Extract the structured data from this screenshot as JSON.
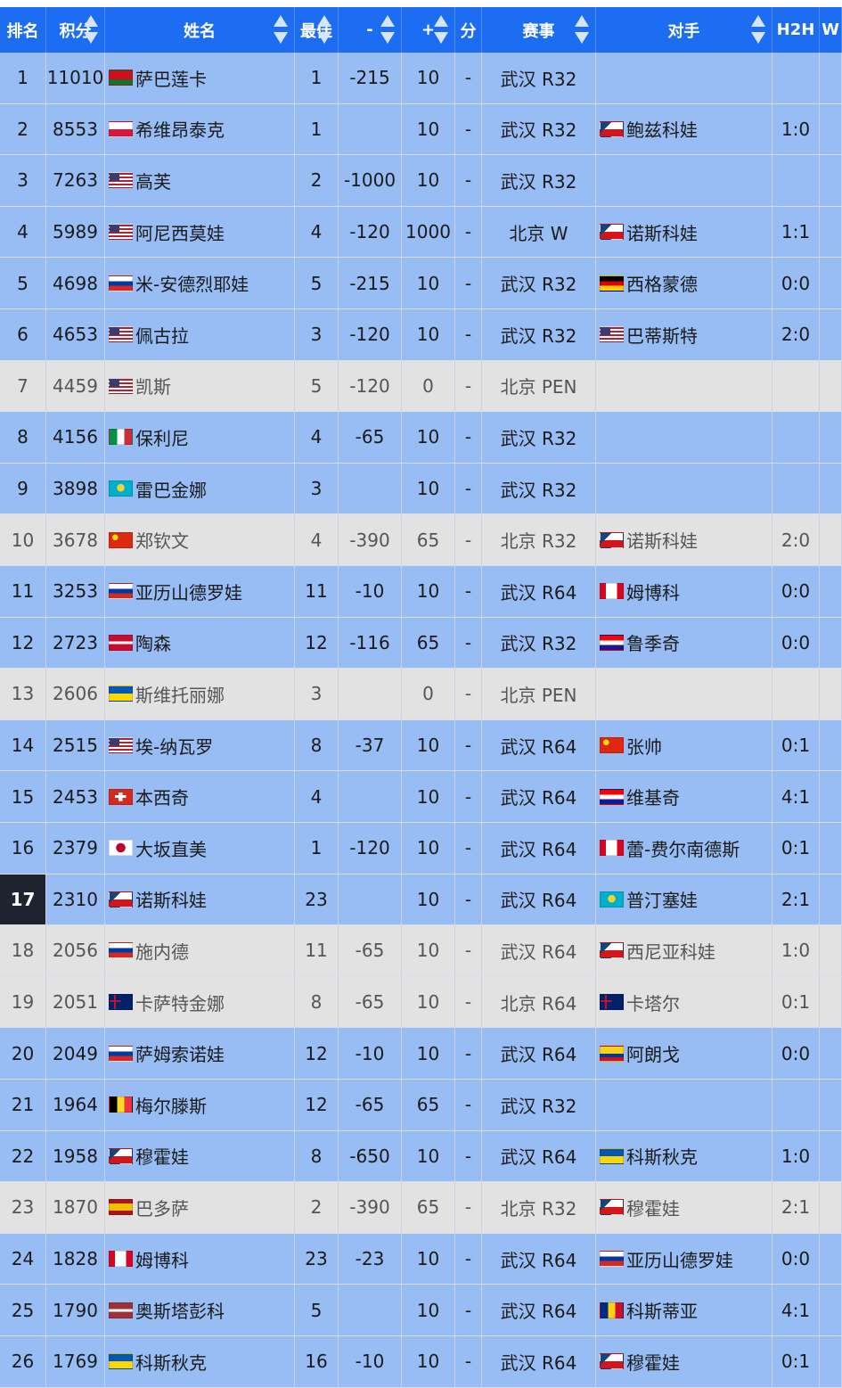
{
  "columns": [
    {
      "label": "排名",
      "sortable": false
    },
    {
      "label": "积分",
      "sortable": true
    },
    {
      "label": "姓名",
      "sortable": true
    },
    {
      "label": "最佳",
      "sortable": true
    },
    {
      "label": "-",
      "sortable": true
    },
    {
      "label": "+",
      "sortable": true
    },
    {
      "label": "分",
      "sortable": true
    },
    {
      "label": "赛事",
      "sortable": true
    },
    {
      "label": "对手",
      "sortable": true
    },
    {
      "label": "H2H",
      "sortable": false
    },
    {
      "label": "W",
      "sortable": false
    }
  ],
  "highlight_rank": "17",
  "colors": {
    "header": "#1c6df2",
    "row_active": "#97bdf4",
    "row_out": "#e2e2e2",
    "rank_badge": "#1d2430"
  },
  "rows": [
    {
      "rank": "1",
      "points": "11010",
      "flag": "BLR",
      "name": "萨巴莲卡",
      "best": "1",
      "minus": "-215",
      "plus": "10",
      "dash": "-",
      "event": "武汉 R32",
      "opp_flag": "",
      "opponent": "",
      "h2h": "",
      "status": "active"
    },
    {
      "rank": "2",
      "points": "8553",
      "flag": "POL",
      "name": "希维昂泰克",
      "best": "1",
      "minus": "",
      "plus": "10",
      "dash": "-",
      "event": "武汉 R32",
      "opp_flag": "CZE",
      "opponent": "鲍兹科娃",
      "h2h": "1:0",
      "status": "active"
    },
    {
      "rank": "3",
      "points": "7263",
      "flag": "USA",
      "name": "高芙",
      "best": "2",
      "minus": "-1000",
      "plus": "10",
      "dash": "-",
      "event": "武汉 R32",
      "opp_flag": "",
      "opponent": "",
      "h2h": "",
      "status": "active"
    },
    {
      "rank": "4",
      "points": "5989",
      "flag": "USA",
      "name": "阿尼西莫娃",
      "best": "4",
      "minus": "-120",
      "plus": "1000",
      "dash": "-",
      "event": "北京 W",
      "opp_flag": "CZE",
      "opponent": "诺斯科娃",
      "h2h": "1:1",
      "status": "active"
    },
    {
      "rank": "5",
      "points": "4698",
      "flag": "RUS",
      "name": "米-安德烈耶娃",
      "best": "5",
      "minus": "-215",
      "plus": "10",
      "dash": "-",
      "event": "武汉 R32",
      "opp_flag": "GER",
      "opponent": "西格蒙德",
      "h2h": "0:0",
      "status": "active"
    },
    {
      "rank": "6",
      "points": "4653",
      "flag": "USA",
      "name": "佩古拉",
      "best": "3",
      "minus": "-120",
      "plus": "10",
      "dash": "-",
      "event": "武汉 R32",
      "opp_flag": "USA",
      "opponent": "巴蒂斯特",
      "h2h": "2:0",
      "status": "active"
    },
    {
      "rank": "7",
      "points": "4459",
      "flag": "USA",
      "name": "凯斯",
      "best": "5",
      "minus": "-120",
      "plus": "0",
      "dash": "-",
      "event": "北京 PEN",
      "opp_flag": "",
      "opponent": "",
      "h2h": "",
      "status": "out"
    },
    {
      "rank": "8",
      "points": "4156",
      "flag": "ITA",
      "name": "保利尼",
      "best": "4",
      "minus": "-65",
      "plus": "10",
      "dash": "-",
      "event": "武汉 R32",
      "opp_flag": "",
      "opponent": "",
      "h2h": "",
      "status": "active"
    },
    {
      "rank": "9",
      "points": "3898",
      "flag": "KAZ",
      "name": "雷巴金娜",
      "best": "3",
      "minus": "",
      "plus": "10",
      "dash": "-",
      "event": "武汉 R32",
      "opp_flag": "",
      "opponent": "",
      "h2h": "",
      "status": "active"
    },
    {
      "rank": "10",
      "points": "3678",
      "flag": "CHN",
      "name": "郑钦文",
      "best": "4",
      "minus": "-390",
      "plus": "65",
      "dash": "-",
      "event": "北京 R32",
      "opp_flag": "CZE",
      "opponent": "诺斯科娃",
      "h2h": "2:0",
      "status": "out"
    },
    {
      "rank": "11",
      "points": "3253",
      "flag": "RUS",
      "name": "亚历山德罗娃",
      "best": "11",
      "minus": "-10",
      "plus": "10",
      "dash": "-",
      "event": "武汉 R64",
      "opp_flag": "CAN",
      "opponent": "姆博科",
      "h2h": "0:0",
      "status": "active"
    },
    {
      "rank": "12",
      "points": "2723",
      "flag": "DEN",
      "name": "陶森",
      "best": "12",
      "minus": "-116",
      "plus": "65",
      "dash": "-",
      "event": "武汉 R32",
      "opp_flag": "CRO",
      "opponent": "鲁季奇",
      "h2h": "0:0",
      "status": "active"
    },
    {
      "rank": "13",
      "points": "2606",
      "flag": "UKR",
      "name": "斯维托丽娜",
      "best": "3",
      "minus": "",
      "plus": "0",
      "dash": "-",
      "event": "北京 PEN",
      "opp_flag": "",
      "opponent": "",
      "h2h": "",
      "status": "out"
    },
    {
      "rank": "14",
      "points": "2515",
      "flag": "USA",
      "name": "埃-纳瓦罗",
      "best": "8",
      "minus": "-37",
      "plus": "10",
      "dash": "-",
      "event": "武汉 R64",
      "opp_flag": "CHN",
      "opponent": "张帅",
      "h2h": "0:1",
      "status": "active"
    },
    {
      "rank": "15",
      "points": "2453",
      "flag": "SUI",
      "name": "本西奇",
      "best": "4",
      "minus": "",
      "plus": "10",
      "dash": "-",
      "event": "武汉 R64",
      "opp_flag": "CRO",
      "opponent": "维基奇",
      "h2h": "4:1",
      "status": "active"
    },
    {
      "rank": "16",
      "points": "2379",
      "flag": "JPN",
      "name": "大坂直美",
      "best": "1",
      "minus": "-120",
      "plus": "10",
      "dash": "-",
      "event": "武汉 R64",
      "opp_flag": "CAN",
      "opponent": "蕾-费尔南德斯",
      "h2h": "0:1",
      "status": "active"
    },
    {
      "rank": "17",
      "points": "2310",
      "flag": "CZE",
      "name": "诺斯科娃",
      "best": "23",
      "minus": "",
      "plus": "10",
      "dash": "-",
      "event": "武汉 R64",
      "opp_flag": "KAZ",
      "opponent": "普汀塞娃",
      "h2h": "2:1",
      "status": "active"
    },
    {
      "rank": "18",
      "points": "2056",
      "flag": "RUS",
      "name": "施内德",
      "best": "11",
      "minus": "-65",
      "plus": "10",
      "dash": "-",
      "event": "武汉 R64",
      "opp_flag": "CZE",
      "opponent": "西尼亚科娃",
      "h2h": "1:0",
      "status": "out"
    },
    {
      "rank": "19",
      "points": "2051",
      "flag": "AUS",
      "name": "卡萨特金娜",
      "best": "8",
      "minus": "-65",
      "plus": "10",
      "dash": "-",
      "event": "北京 R64",
      "opp_flag": "GBR",
      "opponent": "卡塔尔",
      "h2h": "0:1",
      "status": "out"
    },
    {
      "rank": "20",
      "points": "2049",
      "flag": "RUS",
      "name": "萨姆索诺娃",
      "best": "12",
      "minus": "-10",
      "plus": "10",
      "dash": "-",
      "event": "武汉 R64",
      "opp_flag": "COL",
      "opponent": "阿朗戈",
      "h2h": "0:0",
      "status": "active"
    },
    {
      "rank": "21",
      "points": "1964",
      "flag": "BEL",
      "name": "梅尔滕斯",
      "best": "12",
      "minus": "-65",
      "plus": "65",
      "dash": "-",
      "event": "武汉 R32",
      "opp_flag": "",
      "opponent": "",
      "h2h": "",
      "status": "active"
    },
    {
      "rank": "22",
      "points": "1958",
      "flag": "CZE",
      "name": "穆霍娃",
      "best": "8",
      "minus": "-650",
      "plus": "10",
      "dash": "-",
      "event": "武汉 R64",
      "opp_flag": "UKR",
      "opponent": "科斯秋克",
      "h2h": "1:0",
      "status": "active"
    },
    {
      "rank": "23",
      "points": "1870",
      "flag": "ESP",
      "name": "巴多萨",
      "best": "2",
      "minus": "-390",
      "plus": "65",
      "dash": "-",
      "event": "北京 R32",
      "opp_flag": "CZE",
      "opponent": "穆霍娃",
      "h2h": "2:1",
      "status": "out"
    },
    {
      "rank": "24",
      "points": "1828",
      "flag": "CAN",
      "name": "姆博科",
      "best": "23",
      "minus": "-23",
      "plus": "10",
      "dash": "-",
      "event": "武汉 R64",
      "opp_flag": "RUS",
      "opponent": "亚历山德罗娃",
      "h2h": "0:0",
      "status": "active"
    },
    {
      "rank": "25",
      "points": "1790",
      "flag": "LAT",
      "name": "奥斯塔彭科",
      "best": "5",
      "minus": "",
      "plus": "10",
      "dash": "-",
      "event": "武汉 R64",
      "opp_flag": "ROU",
      "opponent": "科斯蒂亚",
      "h2h": "4:1",
      "status": "active"
    },
    {
      "rank": "26",
      "points": "1769",
      "flag": "UKR",
      "name": "科斯秋克",
      "best": "16",
      "minus": "-10",
      "plus": "10",
      "dash": "-",
      "event": "武汉 R64",
      "opp_flag": "CZE",
      "opponent": "穆霍娃",
      "h2h": "0:1",
      "status": "active"
    }
  ]
}
